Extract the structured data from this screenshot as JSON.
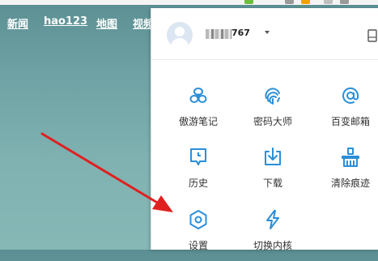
{
  "nav": {
    "links": [
      "新闻",
      "hao123",
      "地图",
      "视频"
    ]
  },
  "account": {
    "username_suffix": "767"
  },
  "menu": {
    "items": [
      {
        "label": "傲游笔记",
        "icon": "notes-icon"
      },
      {
        "label": "密码大师",
        "icon": "fingerprint-icon"
      },
      {
        "label": "百变邮箱",
        "icon": "email-at-icon"
      },
      {
        "label": "历史",
        "icon": "history-icon"
      },
      {
        "label": "下载",
        "icon": "download-icon"
      },
      {
        "label": "清除痕迹",
        "icon": "clear-traces-icon"
      },
      {
        "label": "设置",
        "icon": "settings-gear-icon"
      },
      {
        "label": "切换内核",
        "icon": "switch-kernel-icon"
      }
    ]
  },
  "colors": {
    "accent": "#2b8fd8",
    "arrow": "#e02020",
    "background": "#6fa2a4"
  }
}
